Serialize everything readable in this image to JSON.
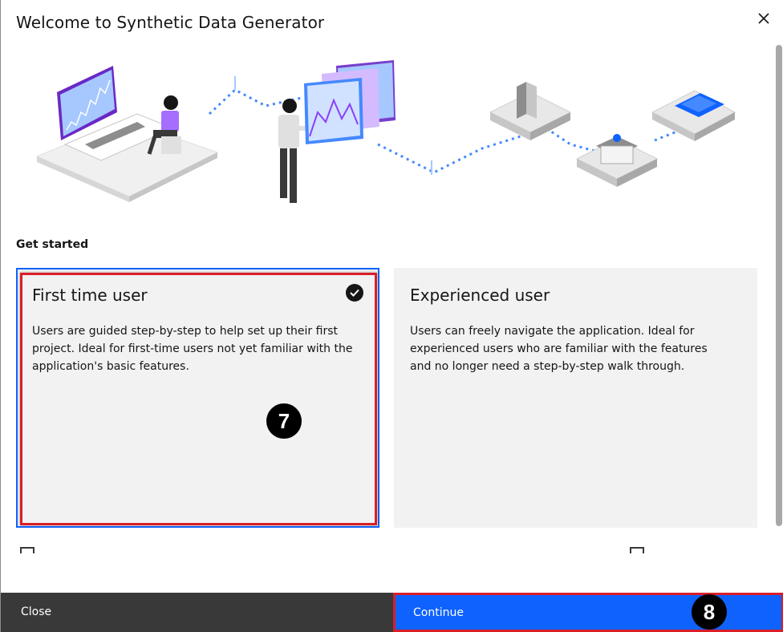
{
  "dialog": {
    "title": "Welcome to Synthetic Data Generator",
    "close_icon": "close-icon"
  },
  "section": {
    "label": "Get started"
  },
  "tiles": [
    {
      "title": "First time user",
      "description": "Users are guided step-by-step to help set up their first project. Ideal for first-time users not yet familiar with the application's basic features.",
      "selected": true
    },
    {
      "title": "Experienced user",
      "description": "Users can freely navigate the application. Ideal for experienced users who are familiar with the features and no longer need a step-by-step walk through.",
      "selected": false
    }
  ],
  "annotations": {
    "step_7": "7",
    "step_8": "8"
  },
  "footer": {
    "close_label": "Close",
    "continue_label": "Continue"
  },
  "colors": {
    "primary": "#0f62fe",
    "secondary": "#393939",
    "highlight": "#da1e28",
    "tile_bg": "#f2f2f2"
  }
}
